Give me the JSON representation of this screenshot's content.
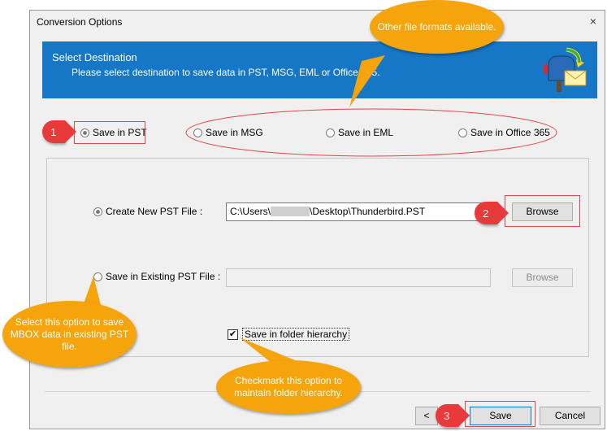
{
  "window": {
    "title": "Conversion Options",
    "close_glyph": "×"
  },
  "header": {
    "title": "Select Destination",
    "subtitle": "Please select destination to save data in PST, MSG, EML or Office 365.",
    "icon": "mailbox-convert-icon"
  },
  "destinations": [
    {
      "label": "Save in PST",
      "selected": true
    },
    {
      "label": "Save in MSG",
      "selected": false
    },
    {
      "label": "Save in EML",
      "selected": false
    },
    {
      "label": "Save in Office 365",
      "selected": false
    }
  ],
  "pst_options": {
    "create_new_label": "Create New PST File :",
    "create_new_selected": true,
    "path_prefix": "C:\\Users\\",
    "path_suffix": "\\Desktop\\Thunderbird.PST",
    "browse_label": "Browse",
    "existing_label": "Save in Existing PST File :",
    "existing_selected": false,
    "existing_path": "",
    "existing_browse_label": "Browse",
    "folder_hierarchy_label": "Save in folder hierarchy",
    "folder_hierarchy_checked": true,
    "check_glyph": "✔"
  },
  "footer": {
    "back_label": "<",
    "save_label": "Save",
    "cancel_label": "Cancel"
  },
  "annotations": {
    "formats_note": "Other file formats available.",
    "existing_note": "Select this option to save MBOX data in existing PST file.",
    "hierarchy_note": "Checkmark this option to maintain folder hierarchy.",
    "badge_1": "1",
    "badge_2": "2",
    "badge_3": "3"
  },
  "colors": {
    "header_blue": "#1777c7",
    "callout_orange": "#f5a40c",
    "badge_red": "#e8393b"
  }
}
